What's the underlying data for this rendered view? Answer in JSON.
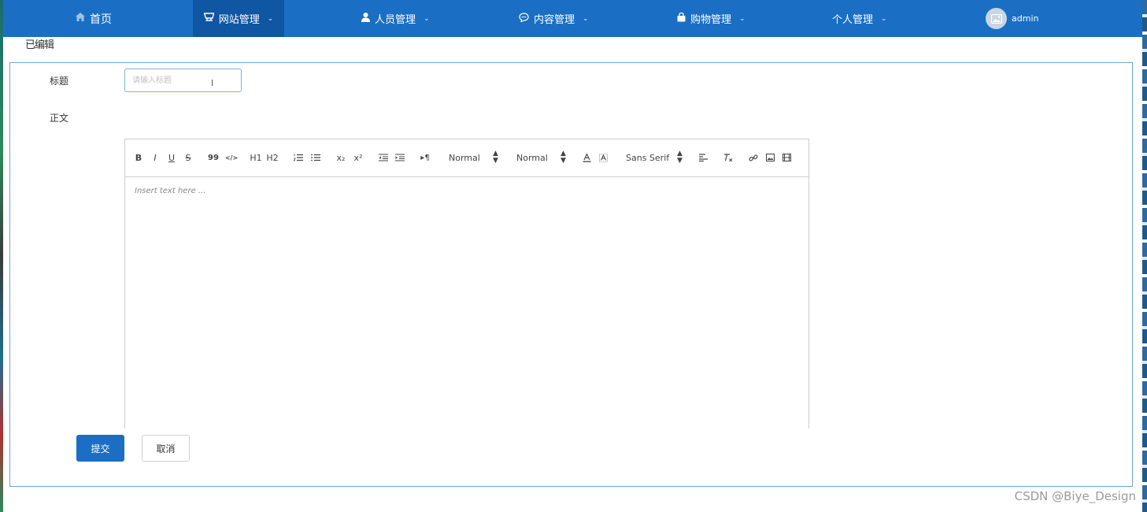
{
  "nav": {
    "home": "首页",
    "site_management": "网站管理",
    "people_management": "人员管理",
    "content_management": "内容管理",
    "shopping_management": "购物管理",
    "personal_management": "个人管理",
    "user": "admin"
  },
  "page": {
    "title": "已编辑"
  },
  "form": {
    "title_label": "标题",
    "title_placeholder": "请输入标题",
    "title_value": "",
    "body_label": "正文",
    "submit_label": "提交",
    "cancel_label": "取消"
  },
  "editor": {
    "placeholder": "Insert text here ...",
    "toolbar": {
      "bold": "B",
      "italic": "I",
      "underline": "U",
      "strike": "S",
      "blockquote": "99",
      "code": "</>",
      "h1": "H1",
      "h2": "H2",
      "subscript": "x₂",
      "superscript": "x²",
      "rtl": "▸¶",
      "size_picker": "Normal",
      "header_picker": "Normal",
      "font_picker": "Sans Serif"
    }
  },
  "watermark": "CSDN @Biye_Design",
  "colors": {
    "nav_bg": "#1a6fc4",
    "nav_active": "#0f56a3",
    "primary_button": "#1a6fc4",
    "card_border": "#6aa6d4"
  }
}
